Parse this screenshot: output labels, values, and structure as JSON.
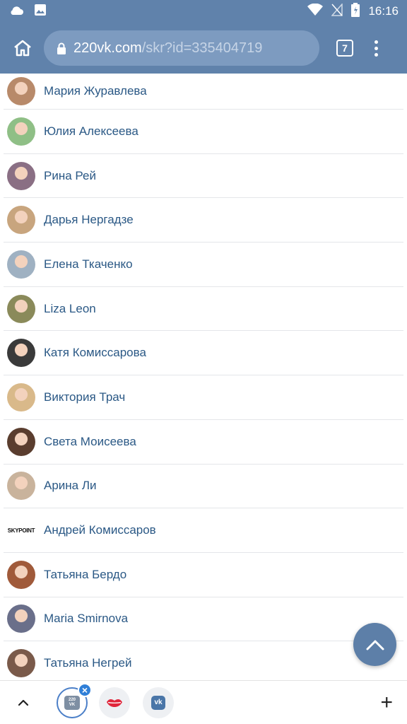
{
  "status": {
    "time": "16:16"
  },
  "browser": {
    "url_host": "220vk.com",
    "url_path": "/skr?id=335404719",
    "tab_count": "7"
  },
  "people": [
    {
      "name": "Мария Журавлева",
      "avatar_color": "#b88a6a"
    },
    {
      "name": "Юлия Алексеева",
      "avatar_color": "#8fbf86"
    },
    {
      "name": "Рина Рей",
      "avatar_color": "#8a6f84"
    },
    {
      "name": "Дарья Нергадзе",
      "avatar_color": "#c8a57e"
    },
    {
      "name": "Елена Ткаченко",
      "avatar_color": "#9fb1c2"
    },
    {
      "name": "Liza Leon",
      "avatar_color": "#8a8a5a"
    },
    {
      "name": "Катя Комиссарова",
      "avatar_color": "#3a3a3a"
    },
    {
      "name": "Виктория Трач",
      "avatar_color": "#d9b98a"
    },
    {
      "name": "Света Моисеева",
      "avatar_color": "#5a3d2e"
    },
    {
      "name": "Арина Ли",
      "avatar_color": "#c9b39c"
    },
    {
      "name": "Андрей Комиссаров",
      "avatar_logo": "SKYPOINT"
    },
    {
      "name": "Татьяна Бердо",
      "avatar_color": "#a05a3a"
    },
    {
      "name": "Maria Smirnova",
      "avatar_color": "#6a6f8a"
    },
    {
      "name": "Татьяна Негрей",
      "avatar_color": "#7a5a4a"
    }
  ],
  "bottom_bar": {
    "active_tab_label_top": "220",
    "active_tab_label_bottom": "VK",
    "vk_label": "vk"
  },
  "colors": {
    "header_bg": "#6082ab",
    "link_text": "#2a5885",
    "fab_bg": "#5d7fa8"
  }
}
